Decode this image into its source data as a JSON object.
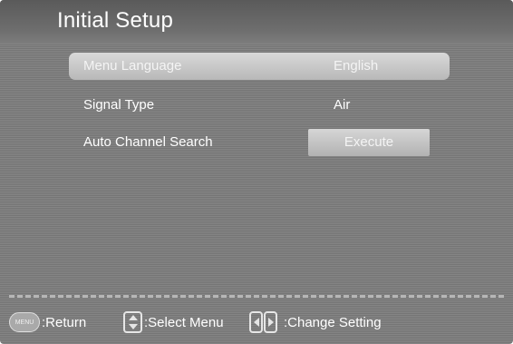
{
  "header": {
    "title": "Initial Setup"
  },
  "menu": {
    "items": [
      {
        "label": "Menu Language",
        "value": "English"
      },
      {
        "label": "Signal Type",
        "value": "Air"
      },
      {
        "label": "Auto Channel Search",
        "button": "Execute"
      }
    ]
  },
  "footer": {
    "menu_key": "MENU",
    "return_text": ":Return",
    "select_text": ":Select Menu",
    "change_text": ":Change Setting"
  },
  "colors": {
    "background": "#7c7c7c",
    "highlight": "#c8c8c8",
    "text": "#ffffff"
  }
}
